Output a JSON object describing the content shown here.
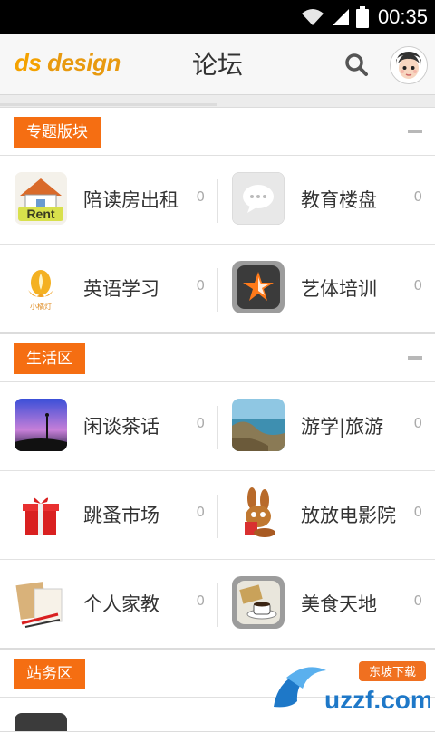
{
  "status_bar": {
    "time": "00:35"
  },
  "header": {
    "logo_part1": "ds",
    "logo_part2": "design",
    "title": "论坛"
  },
  "sections": [
    {
      "title": "专题版块",
      "rows": [
        [
          {
            "label": "陪读房出租",
            "count": "0",
            "icon": "rent-house-icon"
          },
          {
            "label": "教育楼盘",
            "count": "0",
            "icon": "chat-bubble-icon"
          }
        ],
        [
          {
            "label": "英语学习",
            "count": "0",
            "icon": "lamp-icon"
          },
          {
            "label": "艺体培训",
            "count": "0",
            "icon": "star-badge-icon"
          }
        ]
      ]
    },
    {
      "title": "生活区",
      "rows": [
        [
          {
            "label": "闲谈茶话",
            "count": "0",
            "icon": "night-sky-icon"
          },
          {
            "label": "游学|旅游",
            "count": "0",
            "icon": "coast-icon"
          }
        ],
        [
          {
            "label": "跳蚤市场",
            "count": "0",
            "icon": "gift-icon"
          },
          {
            "label": "放放电影院",
            "count": "0",
            "icon": "rabbit-icon"
          }
        ],
        [
          {
            "label": "个人家教",
            "count": "0",
            "icon": "stationery-icon"
          },
          {
            "label": "美食天地",
            "count": "0",
            "icon": "coffee-icon"
          }
        ]
      ]
    },
    {
      "title": "站务区",
      "rows": []
    }
  ],
  "watermark": {
    "brand": "uzzf.com",
    "sub": "东坡下载"
  }
}
